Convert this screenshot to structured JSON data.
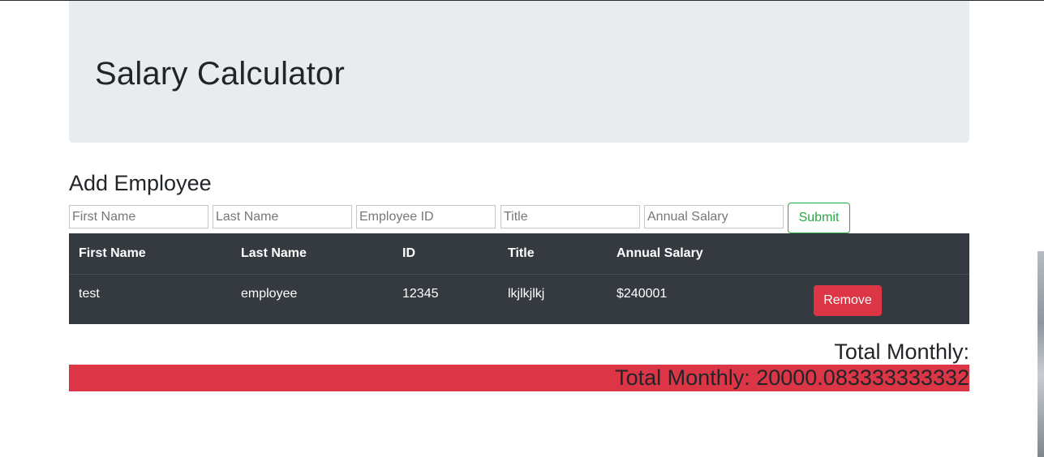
{
  "header": {
    "title": "Salary Calculator"
  },
  "form": {
    "title": "Add Employee",
    "fields": [
      {
        "placeholder": "First Name",
        "value": ""
      },
      {
        "placeholder": "Last Name",
        "value": ""
      },
      {
        "placeholder": "Employee ID",
        "value": ""
      },
      {
        "placeholder": "Title",
        "value": ""
      },
      {
        "placeholder": "Annual Salary",
        "value": ""
      }
    ],
    "submit_label": "Submit"
  },
  "table": {
    "columns": [
      "First Name",
      "Last Name",
      "ID",
      "Title",
      "Annual Salary"
    ],
    "rows": [
      {
        "first_name": "test",
        "last_name": "employee",
        "id": "12345",
        "title": "lkjlkjlkj",
        "annual_salary": "$240001",
        "remove_label": "Remove"
      }
    ]
  },
  "totals": {
    "heading": "Total Monthly:",
    "bar_text": "Total Monthly: 20000.083333333332"
  },
  "colors": {
    "jumbotron_bg": "#e9ecef",
    "table_bg": "#343a40",
    "danger": "#dc3545",
    "success": "#28a745"
  }
}
